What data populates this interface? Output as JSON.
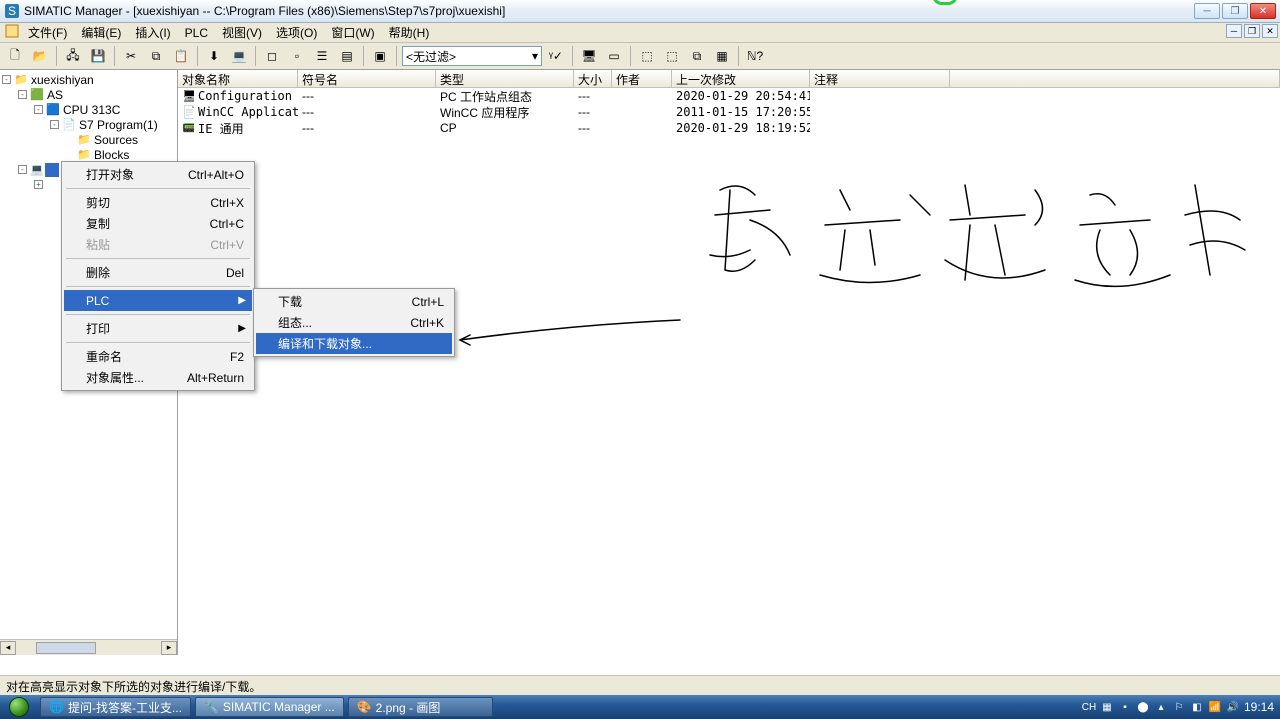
{
  "title": "SIMATIC Manager - [xuexishiyan -- C:\\Program Files (x86)\\Siemens\\Step7\\s7proj\\xuexishi]",
  "menu": {
    "file": "文件(F)",
    "edit": "编辑(E)",
    "insert": "插入(I)",
    "plc": "PLC",
    "view": "视图(V)",
    "options": "选项(O)",
    "window": "窗口(W)",
    "help": "帮助(H)"
  },
  "toolbar": {
    "filter": "<无过滤>"
  },
  "tree": {
    "root": "xuexishiyan",
    "as": "AS",
    "cpu": "CPU 313C",
    "prog": "S7 Program(1)",
    "sources": "Sources",
    "blocks": "Blocks"
  },
  "columns": {
    "name": "对象名称",
    "sym": "符号名",
    "type": "类型",
    "size": "大小",
    "author": "作者",
    "mod": "上一次修改",
    "comment": "注释"
  },
  "rows": [
    {
      "name": "Configuration",
      "sym": "---",
      "type": "PC 工作站点组态",
      "size": "---",
      "mod": "2020-01-29 20:54:41"
    },
    {
      "name": "WinCC Application",
      "sym": "---",
      "type": "WinCC 应用程序",
      "size": "---",
      "mod": "2011-01-15 17:20:55"
    },
    {
      "name": "IE 通用",
      "sym": "---",
      "type": "CP",
      "size": "---",
      "mod": "2020-01-29 18:19:52"
    }
  ],
  "ctx1": {
    "open": "打开对象",
    "open_k": "Ctrl+Alt+O",
    "cut": "剪切",
    "cut_k": "Ctrl+X",
    "copy": "复制",
    "copy_k": "Ctrl+C",
    "paste": "粘贴",
    "paste_k": "Ctrl+V",
    "del": "删除",
    "del_k": "Del",
    "plc": "PLC",
    "print": "打印",
    "rename": "重命名",
    "rename_k": "F2",
    "prop": "对象属性...",
    "prop_k": "Alt+Return"
  },
  "ctx2": {
    "download": "下载",
    "download_k": "Ctrl+L",
    "config": "组态...",
    "config_k": "Ctrl+K",
    "compile": "编译和下载对象..."
  },
  "status": "对在高亮显示对象下所选的对象进行编译/下载。",
  "taskbar": {
    "t1": "提问-找答案-工业支...",
    "t2": "SIMATIC Manager ...",
    "t3": "2.png - 画图",
    "ime": "CH",
    "kbd": "▦",
    "time": "19:14"
  }
}
